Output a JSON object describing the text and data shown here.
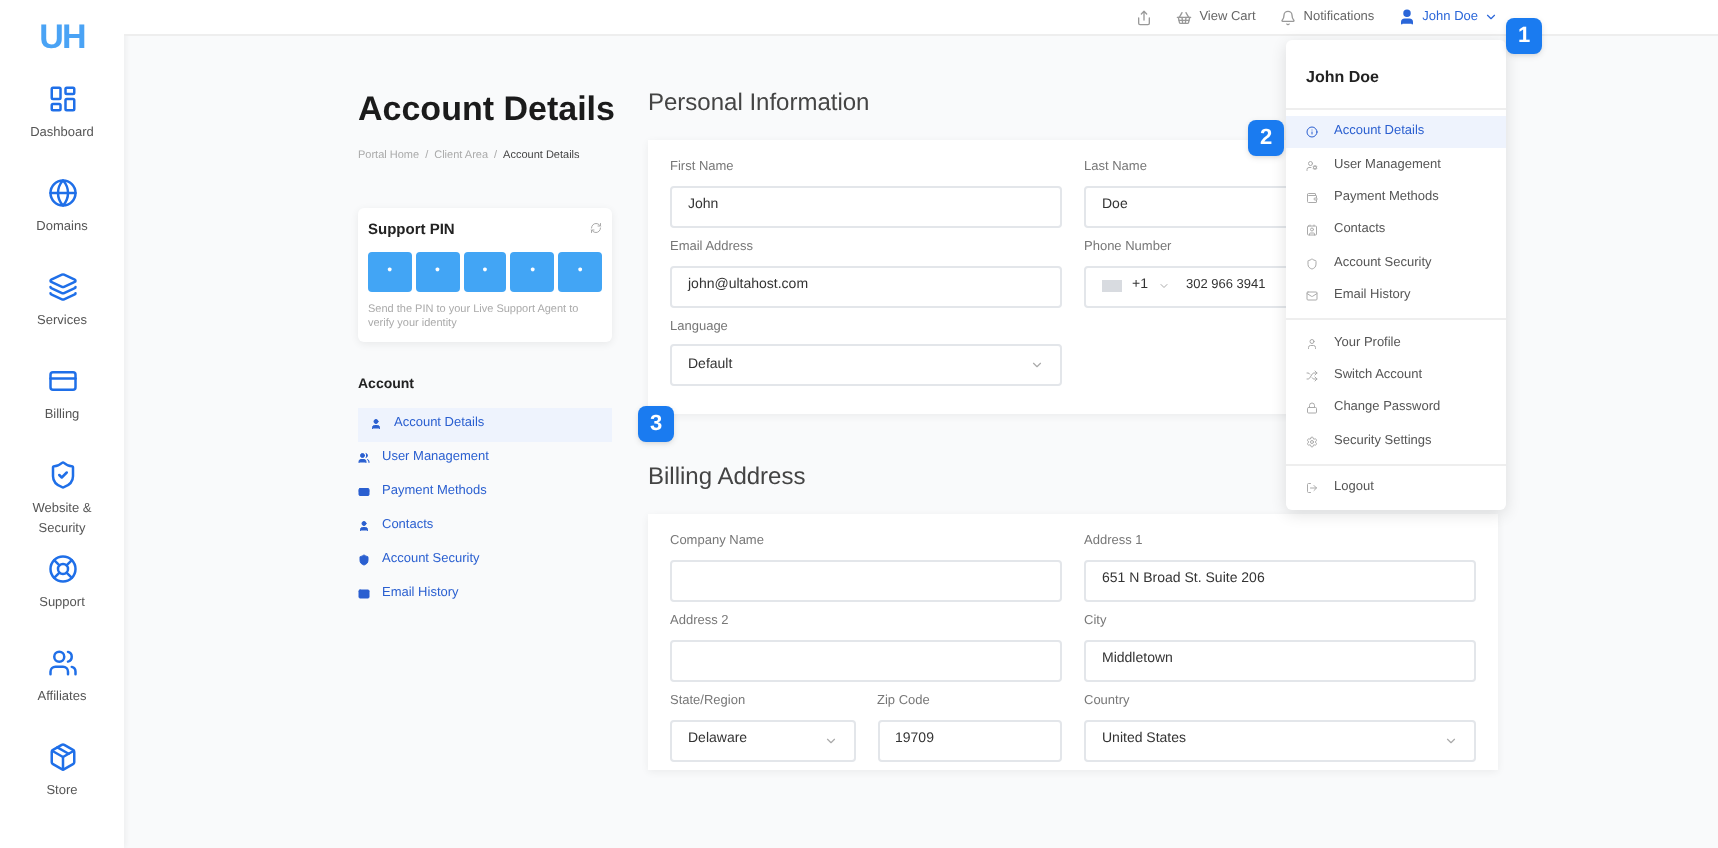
{
  "sidebar": {
    "logo": "UH",
    "items": [
      {
        "label": "Dashboard"
      },
      {
        "label": "Domains"
      },
      {
        "label": "Services"
      },
      {
        "label": "Billing"
      },
      {
        "label": "Website & Security"
      },
      {
        "label": "Support"
      },
      {
        "label": "Affiliates"
      },
      {
        "label": "Store"
      }
    ]
  },
  "top_bar": {
    "view_cart": "View Cart",
    "notifications": "Notifications",
    "user": "John Doe"
  },
  "page": {
    "title": "Account Details",
    "breadcrumb": [
      "Portal Home",
      "Client Area",
      "Account Details"
    ],
    "separator": "/"
  },
  "support_pin": {
    "title": "Support PIN",
    "digits": [
      "•",
      "•",
      "•",
      "•",
      "•"
    ],
    "hint": "Send the PIN to your Live Support Agent to verify your identity"
  },
  "account_nav": {
    "heading": "Account",
    "items": [
      {
        "label": "Account Details",
        "selected": true
      },
      {
        "label": "User Management",
        "selected": false
      },
      {
        "label": "Payment Methods",
        "selected": false
      },
      {
        "label": "Contacts",
        "selected": false
      },
      {
        "label": "Account Security",
        "selected": false
      },
      {
        "label": "Email History",
        "selected": false
      }
    ]
  },
  "personal": {
    "title": "Personal Information",
    "fields": [
      {
        "kind": "text",
        "label": "First Name",
        "value": "John"
      },
      {
        "kind": "text",
        "label": "Last Name",
        "value": "Doe"
      },
      {
        "kind": "text",
        "label": "Email Address",
        "value": "john@ultahost.com"
      },
      {
        "kind": "phone",
        "label": "Phone Number",
        "code": "+1",
        "value": "302 966 3941"
      },
      {
        "kind": "select",
        "label": "Language",
        "value": "Default"
      }
    ]
  },
  "billing": {
    "title": "Billing Address",
    "fields": [
      {
        "kind": "text",
        "label": "Company Name"
      },
      {
        "kind": "text",
        "label": "Address 1",
        "value": "651 N Broad St. Suite 206"
      },
      {
        "kind": "text",
        "label": "Address 2"
      },
      {
        "kind": "text",
        "label": "City",
        "value": "Middletown"
      },
      {
        "kind": "select",
        "label": "State/Region",
        "value": "Delaware"
      },
      {
        "kind": "text",
        "label": "Zip Code",
        "value": "19709"
      },
      {
        "kind": "select",
        "label": "Country",
        "value": "United States"
      }
    ]
  },
  "user_menu": {
    "name": "John Doe",
    "groups": [
      [
        {
          "label": "Account Details",
          "selected": true
        },
        {
          "label": "User Management",
          "selected": false
        },
        {
          "label": "Payment Methods",
          "selected": false
        },
        {
          "label": "Contacts",
          "selected": false
        },
        {
          "label": "Account Security",
          "selected": false
        },
        {
          "label": "Email History",
          "selected": false
        }
      ],
      [
        {
          "label": "Your Profile",
          "selected": false
        },
        {
          "label": "Switch Account",
          "selected": false
        },
        {
          "label": "Change Password",
          "selected": false
        },
        {
          "label": "Security Settings",
          "selected": false
        }
      ],
      [
        {
          "label": "Logout",
          "selected": false
        }
      ]
    ]
  },
  "callouts": [
    "1",
    "2",
    "3"
  ]
}
